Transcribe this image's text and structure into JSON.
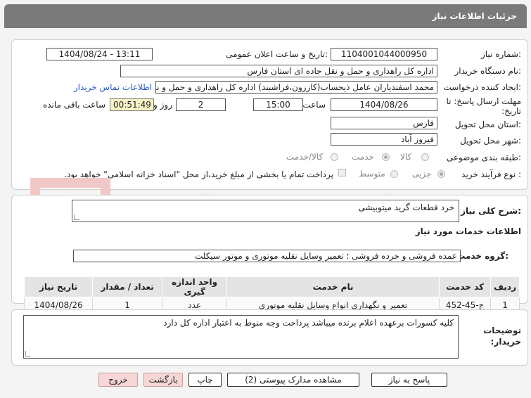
{
  "header": {
    "title": "جزئیات اطلاعات نیاز"
  },
  "need_info": {
    "need_number_label": "شماره نیاز:",
    "need_number": "1104001044000950",
    "announce_label": "تاریخ و ساعت اعلان عمومی:",
    "announce_value": "1404/08/24 - 13:11",
    "buyer_org_label": "نام دستگاه خریدار:",
    "buyer_org": "اداره کل راهداری و حمل و نقل جاده ای استان فارس",
    "requester_label": "ایجاد کننده درخواست:",
    "requester": "محمد اسفندیاران عامل ذیحساب(کازرون،فراشبند) اداره کل راهداری و حمل و نقل",
    "contact_link": "اطلاعات تماس خریدار",
    "deadline_label": "مهلت ارسال پاسخ: تا تاریخ:",
    "deadline_date": "1404/08/26",
    "time_label": "ساعت",
    "deadline_time": "15:00",
    "days_value": "2",
    "days_label": "روز و",
    "remaining_time": "00:51:49",
    "remaining_label": "ساعت باقی مانده",
    "province_label": "استان محل تحویل:",
    "province": "فارس",
    "city_label": "شهر محل تحویل:",
    "city": "فیروز آباد",
    "category_label": "طبقه بندی موضوعی:",
    "category_options": [
      "کالا",
      "خدمت",
      "کالا/خدمت"
    ],
    "process_label": "نوع فرآیند خرید :",
    "process_options": [
      "جزیی",
      "متوسط"
    ],
    "payment_note": "پرداخت تمام یا بخشی از مبلغ خرید،از محل \"اسناد خزانه اسلامی\" خواهد بود."
  },
  "summary": {
    "label": "شرح کلی نیاز:",
    "value": "خرد قطعات گرید میتوبیشی"
  },
  "services": {
    "section_title": "اطلاعات خدمات مورد نیاز",
    "group_label": "گروه خدمت:",
    "group_value": "عمده فروشی و خرده فروشی ؛ تعمیر وسایل نقلیه موتوری و موتور سیکلت",
    "columns": [
      "ردیف",
      "کد خدمت",
      "نام خدمت",
      "واحد اندازه گیری",
      "تعداد / مقدار",
      "تاریخ نیاز"
    ],
    "rows": [
      [
        "1",
        "ج-45-452",
        "تعمیر و نگهداری انواع وسایل نقلیه موتوری",
        "عدد",
        "1",
        "1404/08/26"
      ]
    ]
  },
  "buyer_notes": {
    "label": "توضیحات خریدار:",
    "value": "کلیه کسورات برعهده اعلام برنده میباشد پرداخت وجه منوط به اعتبار اداره کل دارد"
  },
  "buttons": {
    "reply": "پاسخ به نیاز",
    "attachments": "مشاهده مدارک پیوستی (2)",
    "print": "چاپ",
    "back": "بازگشت",
    "exit": "خروج"
  },
  "watermark": {
    "text": "AriaTender.neT"
  },
  "colors": {
    "header": "#7a7a7a",
    "link": "#2a56c6",
    "remaining_bg": "#f7f3c6",
    "button_pink": "#f7d6d6"
  }
}
